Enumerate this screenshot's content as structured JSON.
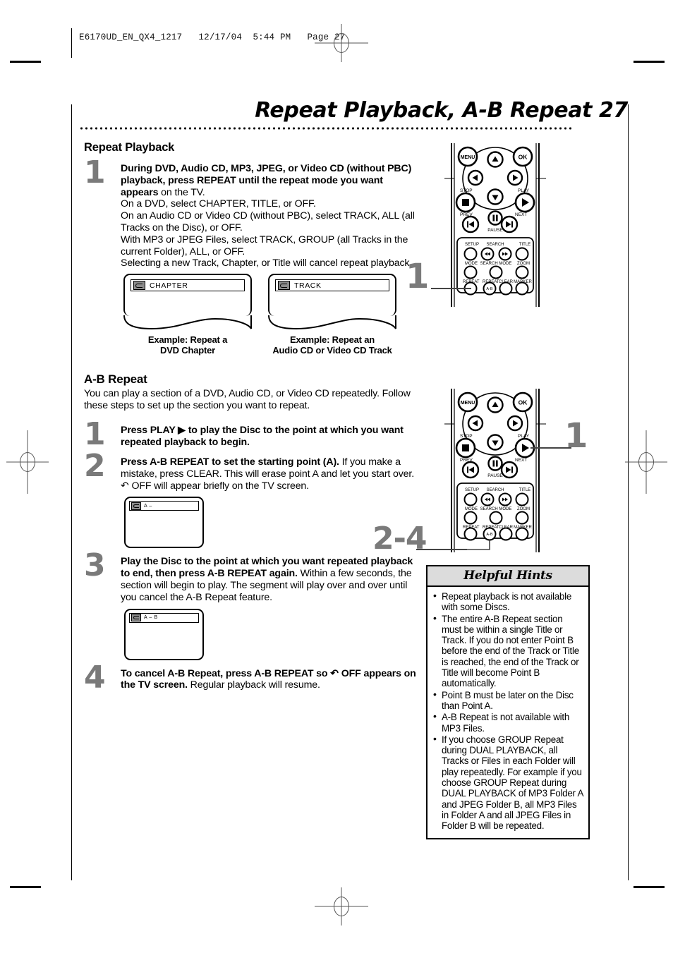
{
  "print_slug": "E6170UD_EN_QX4_1217   12/17/04  5:44 PM   Page 27",
  "header": {
    "title": "Repeat Playback, A-B Repeat  27"
  },
  "repeat_playback": {
    "heading": "Repeat Playback",
    "step1": {
      "number": "1",
      "bold_lead": "During DVD, Audio CD, MP3, JPEG, or Video CD (without PBC) playback, press REPEAT until the repeat mode you want appears",
      "rest": " on the TV.",
      "lines": [
        "On a DVD, select CHAPTER, TITLE, or OFF.",
        "On an Audio CD or Video CD (without PBC), select TRACK, ALL (all Tracks on the Disc), or OFF.",
        "With MP3 or JPEG Files, select TRACK, GROUP (all Tracks in the current Folder), ALL, or OFF.",
        "Selecting a new Track, Chapter, or Title will cancel repeat playback."
      ]
    },
    "examples": [
      {
        "osd_text": "CHAPTER",
        "caption_line1": "Example: Repeat a",
        "caption_line2": "DVD Chapter"
      },
      {
        "osd_text": "TRACK",
        "caption_line1": "Example: Repeat an",
        "caption_line2": "Audio CD or Video CD Track"
      }
    ]
  },
  "ab_repeat": {
    "heading": "A-B Repeat",
    "intro": "You can play a section of a DVD, Audio CD, or Video CD repeatedly. Follow these steps to set up the section you want to repeat.",
    "steps": [
      {
        "number": "1",
        "bold": "Press PLAY ▶ to play the Disc to the point at which you want repeated playback to begin.",
        "rest": ""
      },
      {
        "number": "2",
        "bold": "Press A-B REPEAT to set the starting point (A).",
        "rest": " If you make a mistake, press CLEAR. This will erase point A and let you start over.  ↶  OFF will appear briefly on the TV screen.",
        "osd_text": "A –"
      },
      {
        "number": "3",
        "bold": "Play the Disc to the point at which you want repeated playback to end, then press A-B REPEAT again.",
        "rest": " Within a few seconds, the section will begin to play. The segment will play over and over until you cancel the A-B Repeat feature.",
        "osd_text": "A – B"
      },
      {
        "number": "4",
        "bold": "To cancel A-B Repeat, press A-B REPEAT so  ↶  OFF appears on the TV screen.",
        "rest": " Regular playback will resume."
      }
    ]
  },
  "remote": {
    "labels": {
      "menu": "MENU",
      "ok": "OK",
      "stop": "STOP",
      "play": "PLAY",
      "prev": "PREV",
      "next": "NEXT",
      "pause": "PAUSE",
      "setup": "SETUP",
      "search": "SEARCH",
      "title": "TITLE",
      "mode": "MODE",
      "search_mode": "SEARCH MODE",
      "zoom": "ZOOM",
      "repeat": "REPEAT",
      "repeat_ab": "REPEAT",
      "ab": "A-B",
      "clear": "CLEAR",
      "marker": "MARKER"
    },
    "callout_top": "1",
    "callout_mid": "1",
    "callout_bottom": "2-4"
  },
  "helpful_hints": {
    "heading": "Helpful Hints",
    "items": [
      "Repeat playback is not available with some Discs.",
      "The entire A-B Repeat section must be within a single Title or Track. If you do not enter Point B before the end of the Track or Title is reached, the end of the Track or Title will become Point B automatically.",
      "Point B must be later on the Disc than Point A.",
      "A-B Repeat is not available with MP3 Files.",
      "If you choose GROUP Repeat during DUAL PLAYBACK, all Tracks or Files in each Folder will play repeatedly. For example if you choose GROUP Repeat during DUAL PLAYBACK of MP3 Folder A and JPEG Folder B, all MP3 Files in Folder A and all JPEG Files in Folder B will be repeated."
    ]
  },
  "colors": {
    "step_number": "#7a7a7a",
    "hints_header_bg": "#dcdcdc",
    "ink": "#000000"
  }
}
